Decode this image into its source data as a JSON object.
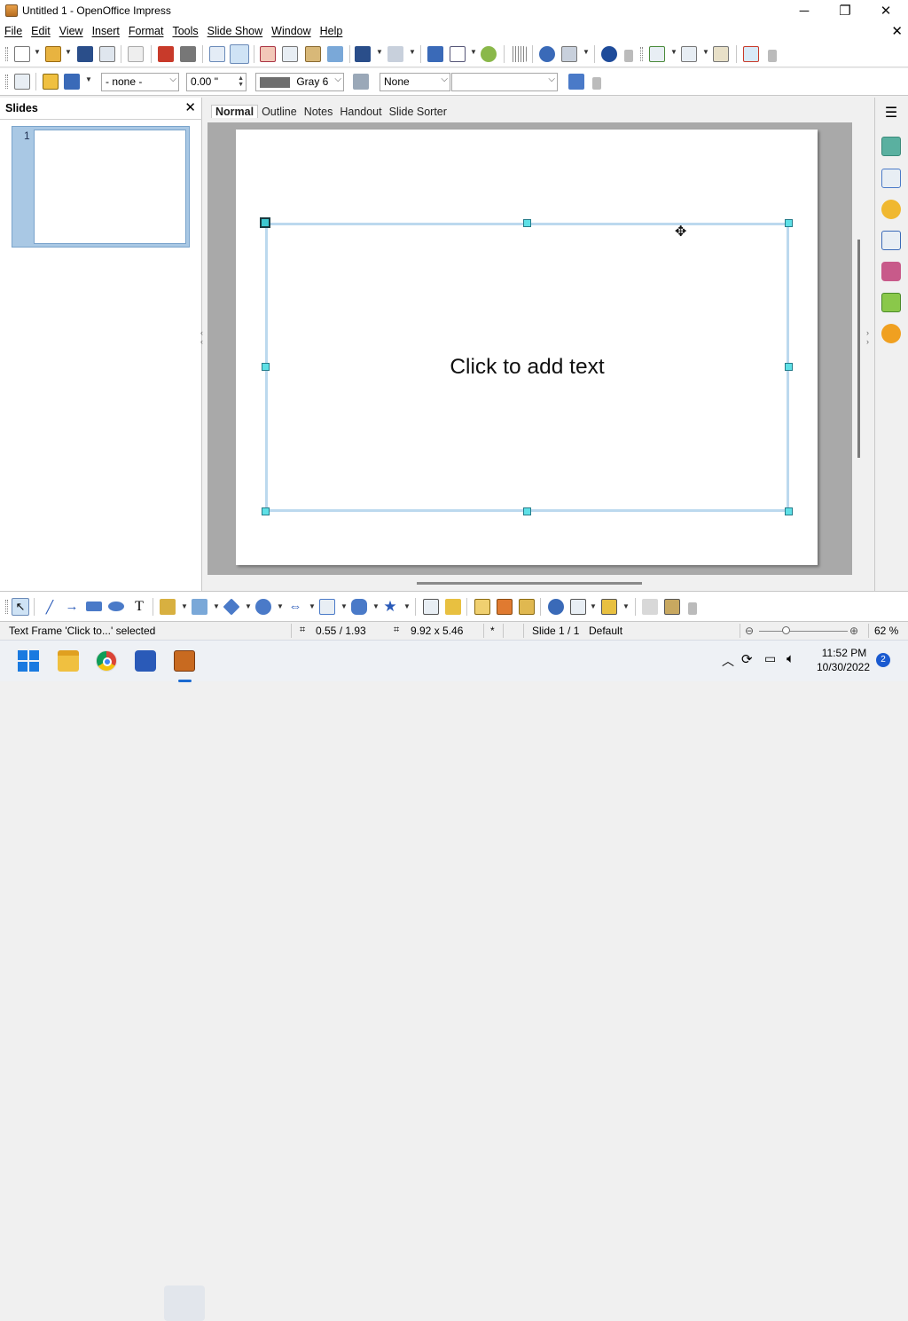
{
  "window": {
    "title": "Untitled 1 - OpenOffice Impress",
    "minimize": "─",
    "maximize": "❐",
    "close": "✕"
  },
  "menubar": {
    "items": [
      "File",
      "Edit",
      "View",
      "Insert",
      "Format",
      "Tools",
      "Slide Show",
      "Window",
      "Help"
    ],
    "doc_close": "✕"
  },
  "line_toolbar": {
    "line_style": "- none -",
    "line_width": "0.00 \"",
    "area_color": "Gray 6",
    "area_style": "None",
    "area_fill": ""
  },
  "slides_panel": {
    "title": "Slides",
    "close": "✕",
    "thumbs": [
      {
        "number": "1"
      }
    ]
  },
  "view_tabs": {
    "items": [
      "Normal",
      "Outline",
      "Notes",
      "Handout",
      "Slide Sorter"
    ],
    "active": "Normal"
  },
  "slide": {
    "placeholder": "Click to add text"
  },
  "statusbar": {
    "selection": "Text Frame 'Click to...' selected",
    "position": "0.55 / 1.93",
    "size": "9.92 x 5.46",
    "modified": "*",
    "slide": "Slide 1 / 1",
    "layout": "Default",
    "zoom": "62 %",
    "zoom_level": 0.62
  },
  "taskbar": {
    "time": "11:52 PM",
    "date": "10/30/2022",
    "notifications": "2"
  },
  "colors": {
    "frame_border": "#bcd9ee",
    "handle": "#5ee0e6",
    "workspace": "#a9a9a9",
    "panel_selected": "#a9c8e4"
  }
}
